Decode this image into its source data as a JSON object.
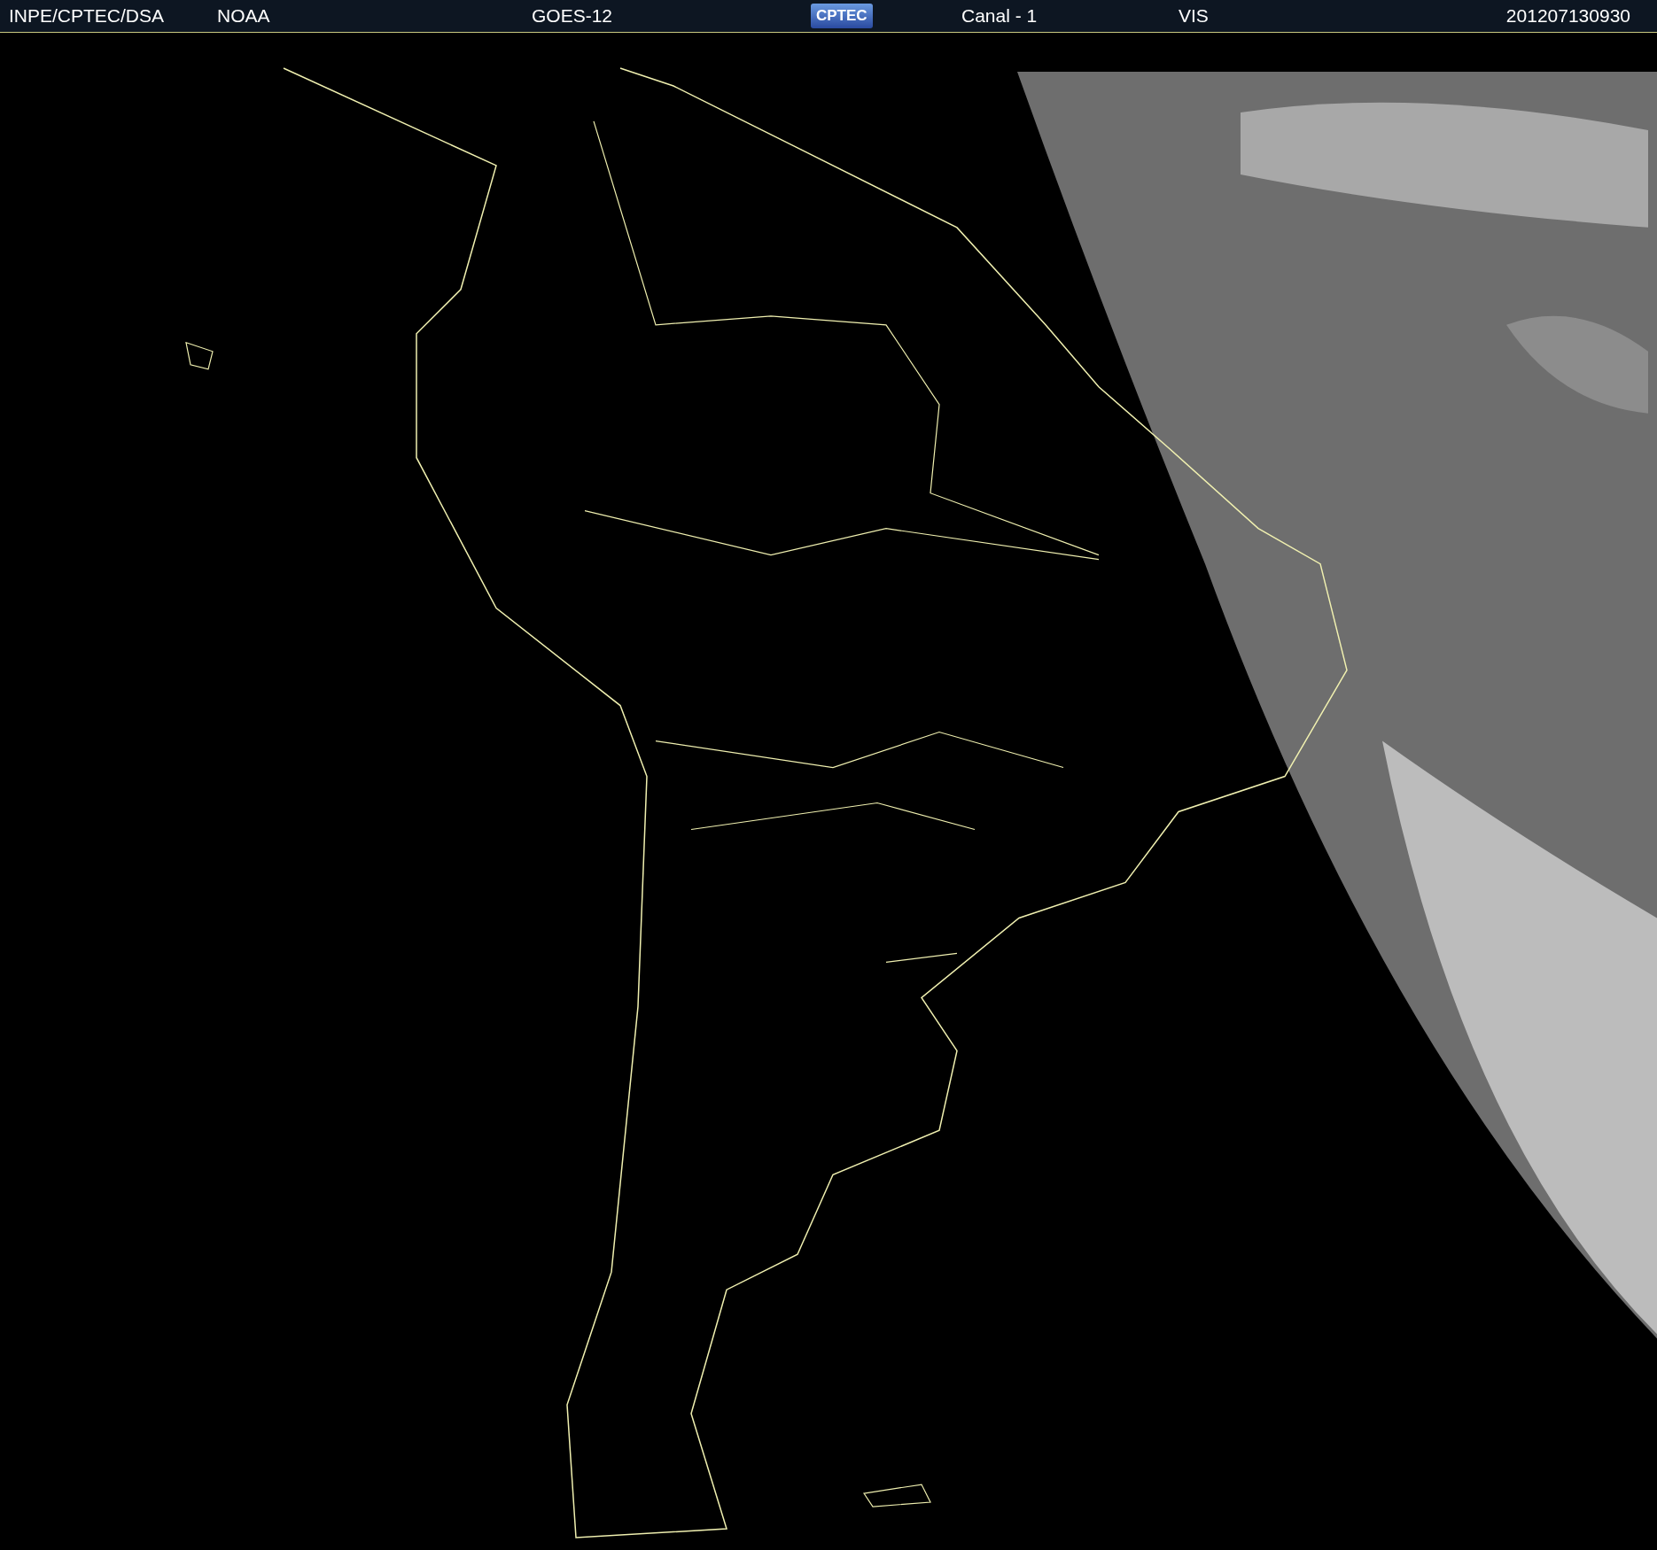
{
  "header": {
    "items": [
      {
        "kind": "text",
        "text": "INPE/CPTEC/DSA"
      },
      {
        "kind": "text",
        "text": "NOAA"
      },
      {
        "kind": "text",
        "text": "GOES-12"
      },
      {
        "kind": "logo",
        "text": "CPTEC"
      },
      {
        "kind": "text",
        "text": "Canal - 1"
      },
      {
        "kind": "text",
        "text": "VIS"
      },
      {
        "kind": "text",
        "text": "201207130930"
      }
    ]
  }
}
